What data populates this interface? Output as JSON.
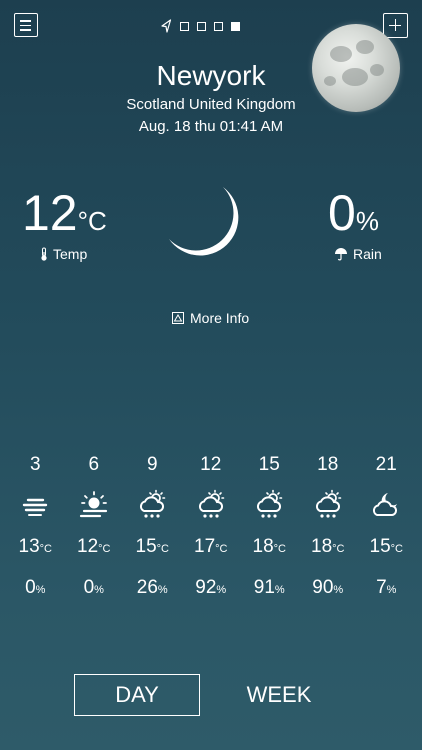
{
  "header": {
    "city": "Newyork",
    "region": "Scotland United Kingdom",
    "datetime": "Aug. 18 thu 01:41 AM"
  },
  "pager": {
    "count": 4,
    "active_index": 3
  },
  "current": {
    "temp_value": "12",
    "temp_unit": "°C",
    "temp_label": "Temp",
    "rain_value": "0",
    "rain_unit": "%",
    "rain_label": "Rain",
    "condition_icon": "crescent-moon-icon"
  },
  "more_info": {
    "label": "More Info"
  },
  "forecast": [
    {
      "hour": "3",
      "icon": "fog-icon",
      "temp": "13",
      "temp_unit": "°C",
      "rain": "0",
      "rain_unit": "%"
    },
    {
      "hour": "6",
      "icon": "sun-haze-icon",
      "temp": "12",
      "temp_unit": "°C",
      "rain": "0",
      "rain_unit": "%"
    },
    {
      "hour": "9",
      "icon": "sun-cloud-rain-icon",
      "temp": "15",
      "temp_unit": "°C",
      "rain": "26",
      "rain_unit": "%"
    },
    {
      "hour": "12",
      "icon": "sun-cloud-rain-icon",
      "temp": "17",
      "temp_unit": "°C",
      "rain": "92",
      "rain_unit": "%"
    },
    {
      "hour": "15",
      "icon": "sun-cloud-rain-icon",
      "temp": "18",
      "temp_unit": "°C",
      "rain": "91",
      "rain_unit": "%"
    },
    {
      "hour": "18",
      "icon": "sun-cloud-rain-icon",
      "temp": "18",
      "temp_unit": "°C",
      "rain": "90",
      "rain_unit": "%"
    },
    {
      "hour": "21",
      "icon": "moon-cloud-icon",
      "temp": "15",
      "temp_unit": "°C",
      "rain": "7",
      "rain_unit": "%"
    }
  ],
  "tabs": {
    "day": "DAY",
    "week": "WEEK",
    "active": "day"
  },
  "colors": {
    "background_top": "#1d3f4f",
    "background_bottom": "#2e5b69",
    "foreground": "#ffffff"
  }
}
